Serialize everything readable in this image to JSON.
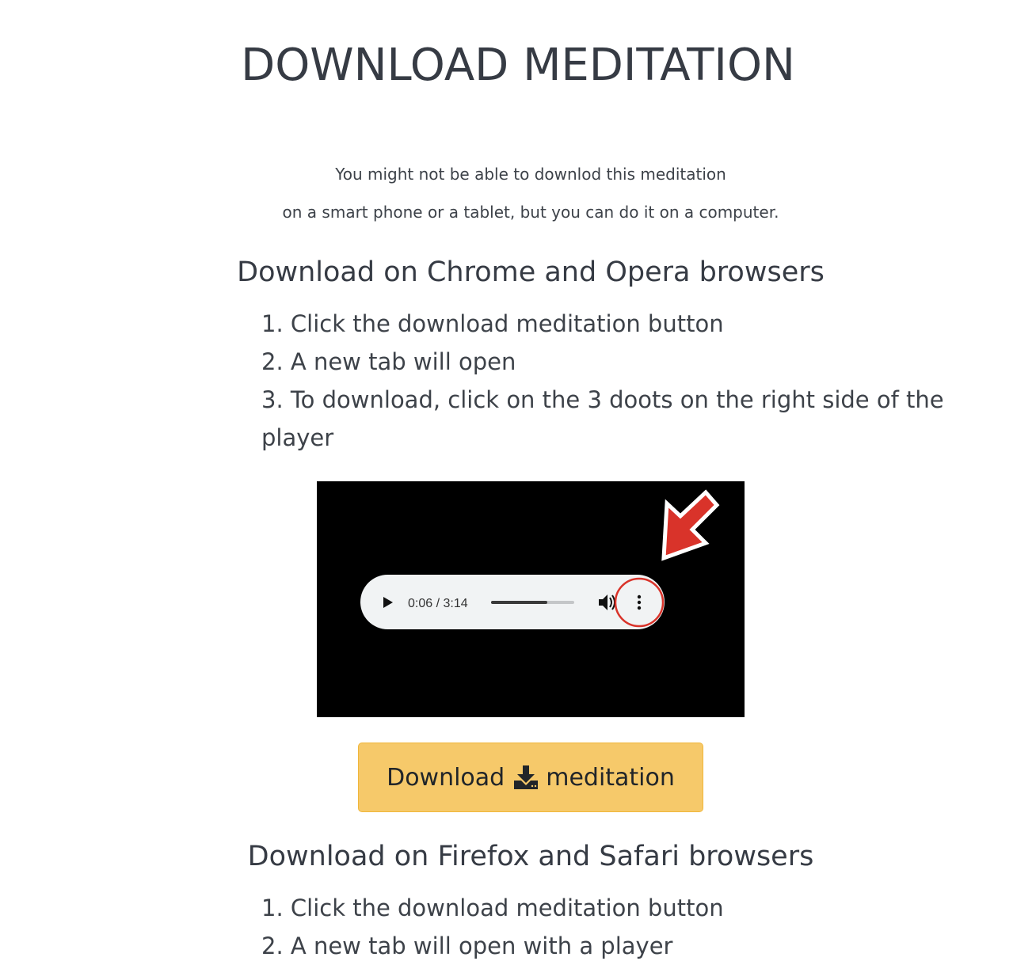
{
  "page": {
    "title": "DOWNLOAD MEDITATION",
    "intro": [
      "You might not be able to downlod this meditation",
      "on a smart phone or a tablet, but you can do it on a computer."
    ]
  },
  "chrome_section": {
    "heading": "Download on Chrome and Opera browsers",
    "steps": [
      "1. Click the download meditation button",
      "2. A new tab will open",
      "3. To download, click on the 3 doots on the right side of the player"
    ]
  },
  "player_image": {
    "time": "0:06 / 3:14",
    "progress": 0.68,
    "icons": [
      "play-icon",
      "volume-icon",
      "more-options-icon",
      "arrow-icon"
    ],
    "colors": {
      "background": "#000000",
      "player": "#f1f3f4",
      "arrow": "#d9332a",
      "highlight_ring": "#d9332a"
    }
  },
  "download_button": {
    "label_before": "Download",
    "label_after": "meditation",
    "icon": "download-icon",
    "colors": {
      "background": "#f6c96a",
      "border": "#f0b63a"
    }
  },
  "firefox_section": {
    "heading": "Download on Firefox and Safari browsers",
    "steps": [
      "1. Click the download meditation button",
      "2. A new tab will open with a player"
    ]
  }
}
